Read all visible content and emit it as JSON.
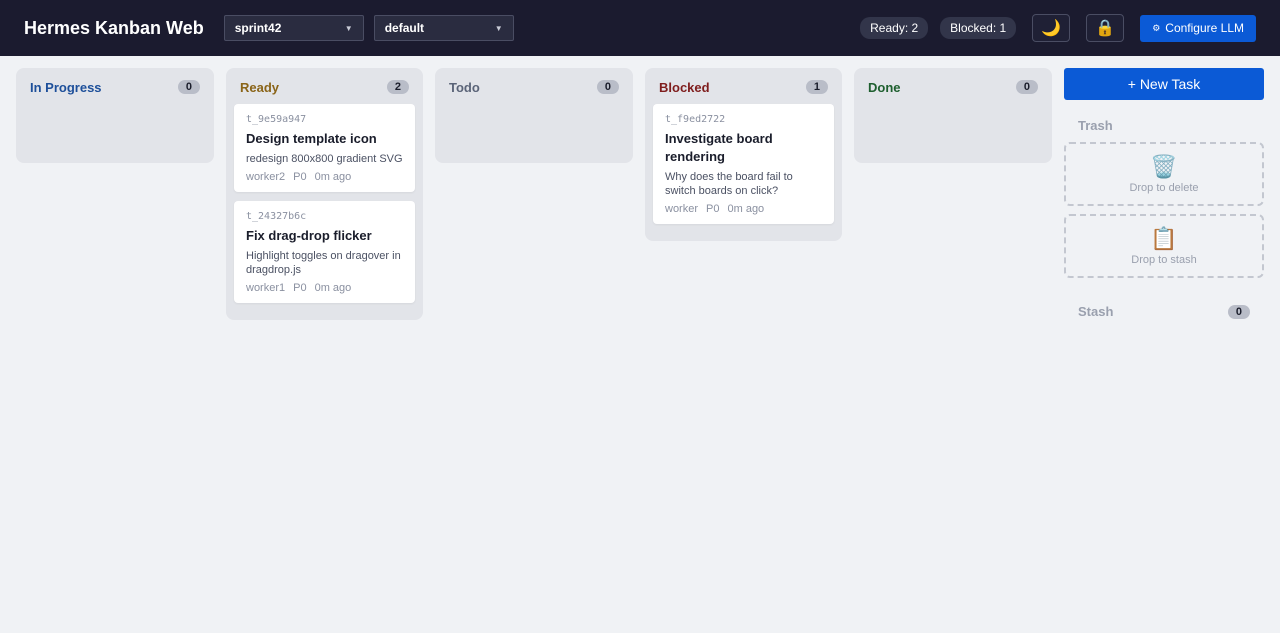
{
  "header": {
    "title": "Hermes Kanban Web",
    "board_select": "sprint42",
    "profile_select": "default",
    "ready_pill": "Ready: 2",
    "blocked_pill": "Blocked: 1",
    "theme_icon": "🌙",
    "lock_icon": "🔒",
    "config_icon": "⚙",
    "config_label": "Configure LLM"
  },
  "columns": {
    "inprogress": {
      "title": "In Progress",
      "count": "0"
    },
    "ready": {
      "title": "Ready",
      "count": "2",
      "cards": [
        {
          "id": "t_9e59a947",
          "title": "Design template icon",
          "desc": "redesign 800x800 gradient SVG",
          "worker": "worker2",
          "priority": "P0",
          "age": "0m ago"
        },
        {
          "id": "t_24327b6c",
          "title": "Fix drag-drop flicker",
          "desc": "Highlight toggles on dragover in dragdrop.js",
          "worker": "worker1",
          "priority": "P0",
          "age": "0m ago"
        }
      ]
    },
    "todo": {
      "title": "Todo",
      "count": "0"
    },
    "blocked": {
      "title": "Blocked",
      "count": "1",
      "cards": [
        {
          "id": "t_f9ed2722",
          "title": "Investigate board rendering",
          "desc": "Why does the board fail to switch boards on click?",
          "worker": "worker",
          "priority": "P0",
          "age": "0m ago"
        }
      ]
    },
    "done": {
      "title": "Done",
      "count": "0"
    }
  },
  "sidebar": {
    "new_task": "+ New Task",
    "trash_label": "Trash",
    "trash_icon": "🗑️",
    "trash_drop": "Drop to delete",
    "stash_icon": "📋",
    "stash_drop": "Drop to stash",
    "stash_label": "Stash",
    "stash_count": "0"
  }
}
